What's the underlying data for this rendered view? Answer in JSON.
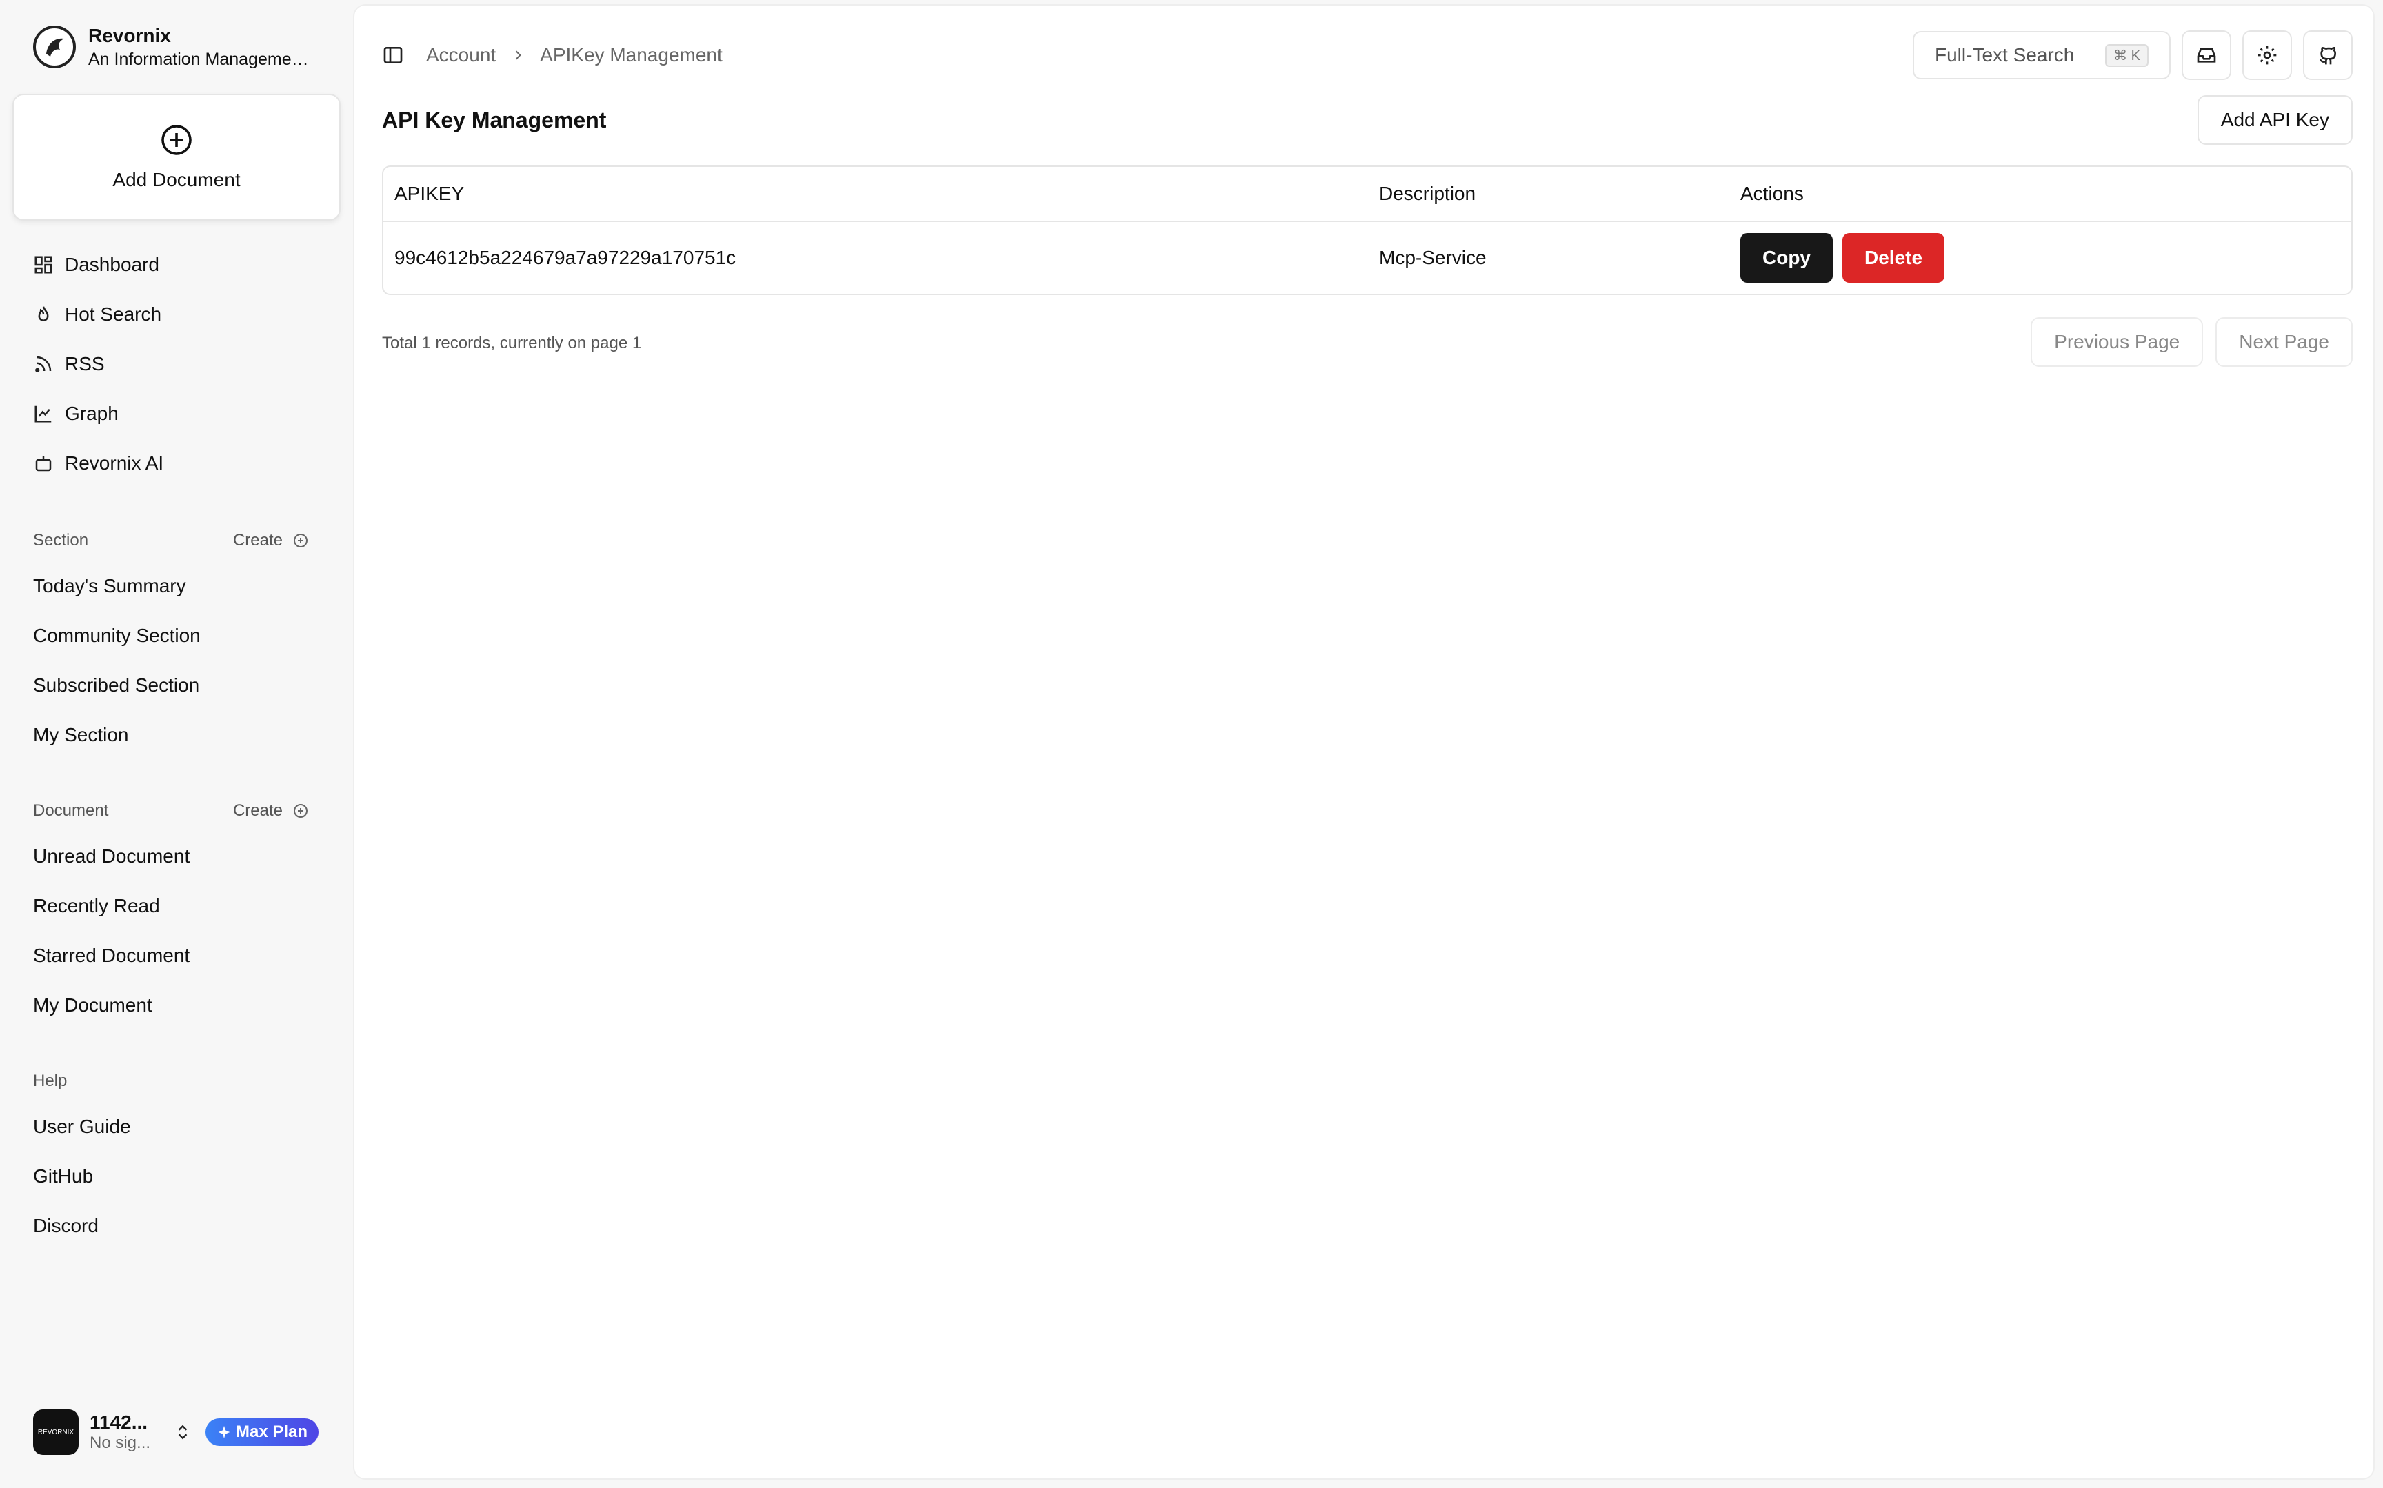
{
  "brand": {
    "name": "Revornix",
    "subtitle": "An Information Management Tool"
  },
  "add_document": {
    "label": "Add Document"
  },
  "nav": [
    {
      "label": "Dashboard",
      "icon": "dashboard-icon"
    },
    {
      "label": "Hot Search",
      "icon": "flame-icon"
    },
    {
      "label": "RSS",
      "icon": "rss-icon"
    },
    {
      "label": "Graph",
      "icon": "graph-icon"
    },
    {
      "label": "Revornix AI",
      "icon": "bot-icon"
    }
  ],
  "section_group": {
    "title": "Section",
    "create_label": "Create",
    "items": [
      "Today's Summary",
      "Community Section",
      "Subscribed Section",
      "My Section"
    ]
  },
  "document_group": {
    "title": "Document",
    "create_label": "Create",
    "items": [
      "Unread Document",
      "Recently Read",
      "Starred Document",
      "My Document"
    ]
  },
  "help_group": {
    "title": "Help",
    "items": [
      "User Guide",
      "GitHub",
      "Discord"
    ]
  },
  "user": {
    "name": "1142...",
    "sub": "No sig...",
    "plan": "Max Plan",
    "avatar_text": "REVORNIX"
  },
  "breadcrumb": {
    "parent": "Account",
    "current": "APIKey Management"
  },
  "topbar": {
    "search_label": "Full-Text Search",
    "shortcut": "⌘ K"
  },
  "page": {
    "title": "API Key Management",
    "add_button": "Add API Key"
  },
  "table": {
    "columns": [
      "APIKEY",
      "Description",
      "Actions"
    ],
    "rows": [
      {
        "apikey": "99c4612b5a224679a7a97229a170751c",
        "description": "Mcp-Service",
        "copy": "Copy",
        "delete": "Delete"
      }
    ]
  },
  "pagination": {
    "info": "Total 1 records, currently on page 1",
    "prev": "Previous Page",
    "next": "Next Page"
  },
  "colors": {
    "primary": "#181818",
    "danger": "#dc2626",
    "badge_from": "#3b82f6",
    "badge_to": "#4f46e5"
  }
}
